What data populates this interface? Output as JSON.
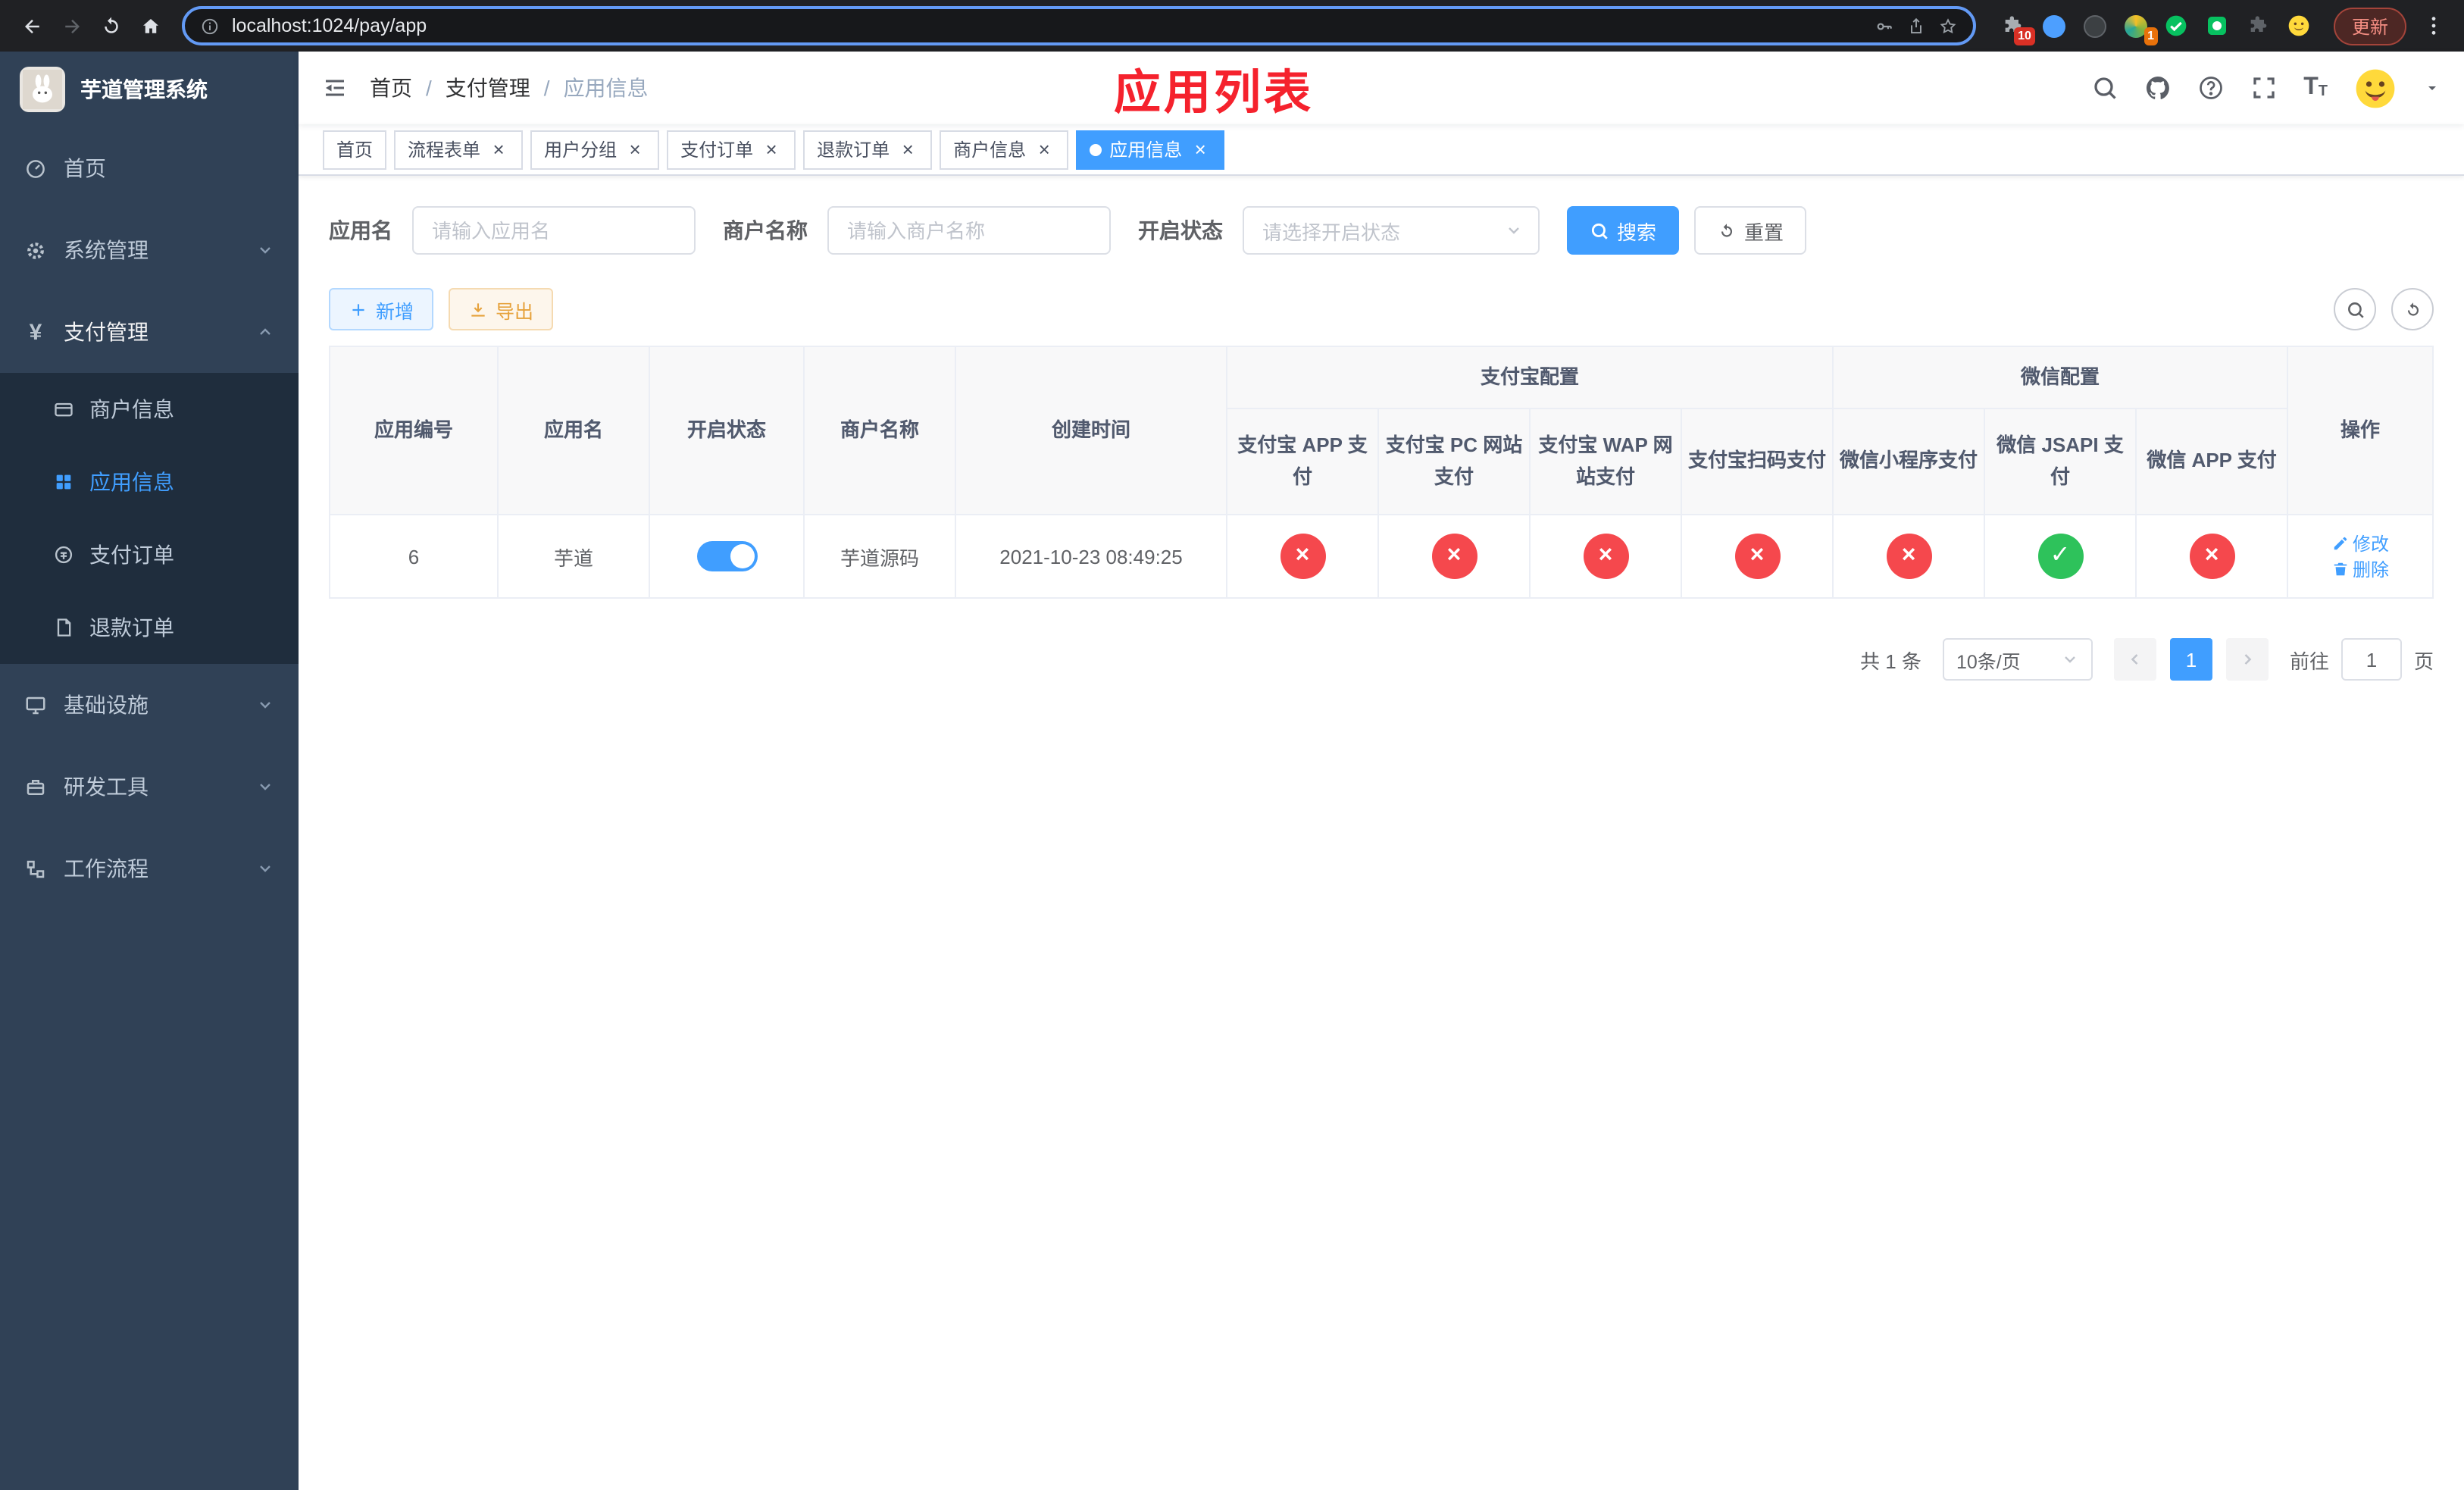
{
  "colors": {
    "primary": "#409eff",
    "success": "#2ec25b",
    "danger": "#f5484d",
    "warning": "#e6a23c",
    "annotation_red": "#f5222d",
    "sidebar_bg": "#304156",
    "submenu_bg": "#1f2d3d"
  },
  "browser": {
    "url": "localhost:1024/pay/app",
    "update_label": "更新",
    "extension_badges": {
      "puzzle": "10",
      "colorful": "1"
    }
  },
  "sidebar": {
    "title": "芋道管理系统",
    "items": [
      {
        "label": "首页"
      },
      {
        "label": "系统管理"
      },
      {
        "label": "支付管理"
      },
      {
        "label": "基础设施"
      },
      {
        "label": "研发工具"
      },
      {
        "label": "工作流程"
      }
    ],
    "pay_submenu": [
      {
        "label": "商户信息"
      },
      {
        "label": "应用信息"
      },
      {
        "label": "支付订单"
      },
      {
        "label": "退款订单"
      }
    ]
  },
  "header": {
    "breadcrumb": [
      "首页",
      "支付管理",
      "应用信息"
    ],
    "separator": "/",
    "annotation": "应用列表"
  },
  "tabs": [
    {
      "label": "首页"
    },
    {
      "label": "流程表单"
    },
    {
      "label": "用户分组"
    },
    {
      "label": "支付订单"
    },
    {
      "label": "退款订单"
    },
    {
      "label": "商户信息"
    },
    {
      "label": "应用信息"
    }
  ],
  "filters": {
    "app_name_label": "应用名",
    "app_name_placeholder": "请输入应用名",
    "merchant_label": "商户名称",
    "merchant_placeholder": "请输入商户名称",
    "status_label": "开启状态",
    "status_placeholder": "请选择开启状态",
    "search_label": "搜索",
    "reset_label": "重置"
  },
  "toolbar": {
    "add_label": "新增",
    "export_label": "导出"
  },
  "table": {
    "headers": {
      "main": [
        "应用编号",
        "应用名",
        "开启状态",
        "商户名称",
        "创建时间"
      ],
      "alipay_group": "支付宝配置",
      "wechat_group": "微信配置",
      "sub": [
        "支付宝 APP 支付",
        "支付宝 PC 网站支付",
        "支付宝 WAP 网站支付",
        "支付宝扫码支付",
        "微信小程序支付",
        "微信 JSAPI 支付",
        "微信 APP 支付"
      ],
      "action": "操作"
    },
    "row": {
      "id": "6",
      "name": "芋道",
      "status_enabled": true,
      "merchant": "芋道源码",
      "created_at": "2021-10-23 08:49:25",
      "configs": [
        false,
        false,
        false,
        false,
        false,
        true,
        false
      ],
      "edit_label": "修改",
      "delete_label": "删除"
    }
  },
  "pagination": {
    "total_label": "共 1 条",
    "page_size_label": "10条/页",
    "current_page": "1",
    "goto_prefix": "前往",
    "goto_value": "1",
    "goto_suffix": "页"
  }
}
